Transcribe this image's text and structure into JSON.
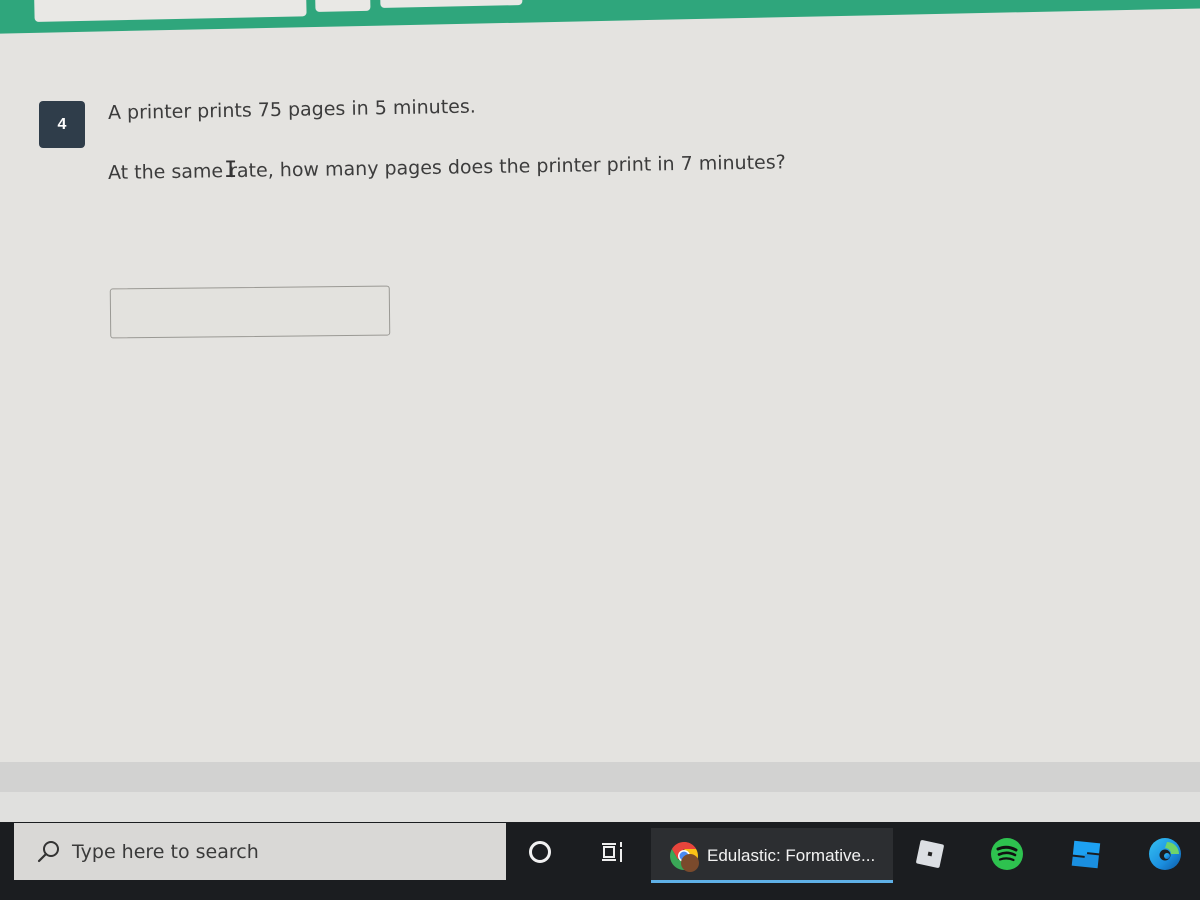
{
  "header": {
    "accent_color": "#2fa67c"
  },
  "question": {
    "number": "4",
    "line1": "A printer prints 75 pages in 5 minutes.",
    "line2": "At the same rate, how many pages does the printer print in 7 minutes?",
    "answer_value": "",
    "answer_placeholder": ""
  },
  "taskbar": {
    "search_placeholder": "Type here to search",
    "icons": {
      "search": "search-icon",
      "cortana": "cortana-icon",
      "task_view": "task-view-icon",
      "chrome": "chrome-icon",
      "roblox": "roblox-icon",
      "spotify": "spotify-icon",
      "roblox_studio": "roblox-studio-icon",
      "edge": "edge-icon"
    },
    "active_app": {
      "label": "Edulastic: Formative...",
      "indicator_color": "#5fb0e6"
    }
  }
}
